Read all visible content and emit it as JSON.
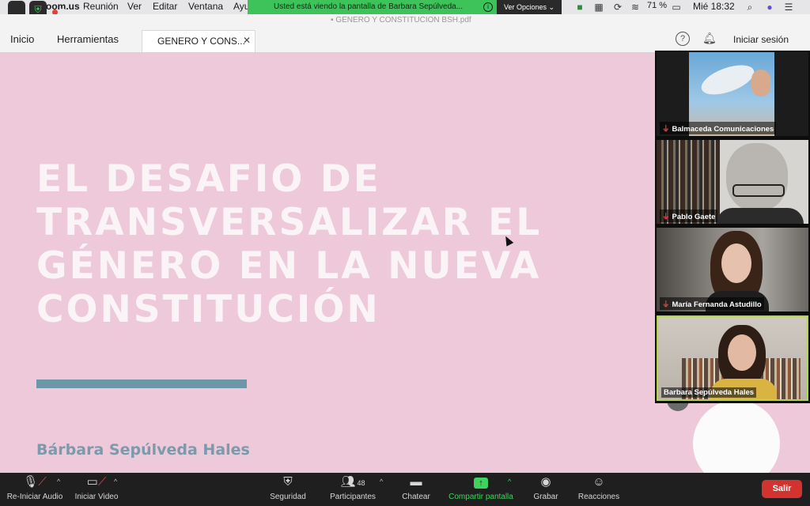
{
  "menubar": {
    "app": "zoom.us",
    "items": [
      "Reunión",
      "Ver",
      "Editar",
      "Ventana",
      "Ayu"
    ],
    "recording": "Recording",
    "battery": "71 %",
    "clock": "Mié 18:32"
  },
  "share_banner": {
    "text": "Usted está viendo la pantalla de Barbara Sepúlveda...",
    "view_options": "Ver Opciones"
  },
  "document": {
    "title": "GENERO Y CONSTITUCION BSH.pdf"
  },
  "tabbar": {
    "home": "Inicio",
    "tools": "Herramientas",
    "active_tab": "GENERO Y CONS...",
    "signin": "Iniciar sesión"
  },
  "slide": {
    "title": "EL DESAFIO DE TRANSVERSALIZAR EL GÉNERO EN LA NUEVA CONSTITUCIÓN",
    "author": "Bárbara Sepúlveda Hales"
  },
  "participants": [
    {
      "name": "Balmaceda Comunicaciones",
      "muted": true
    },
    {
      "name": "Pablo Gaete",
      "muted": true
    },
    {
      "name": "María Fernanda Astudillo",
      "muted": true
    },
    {
      "name": "Barbara Sepúlveda Hales",
      "muted": false,
      "active_speaker": true
    }
  ],
  "toolbar": {
    "audio": "Re-Iniciar Audio",
    "video": "Iniciar Video",
    "security": "Seguridad",
    "participants": "Participantes",
    "participants_count": "48",
    "chat": "Chatear",
    "share": "Compartir pantalla",
    "record": "Grabar",
    "reactions": "Reacciones",
    "leave": "Salir"
  },
  "colors": {
    "slide_bg": "#edc9d9",
    "slide_title": "#fbf4f7",
    "accent_bar": "#6d97a8",
    "author": "#7c9aac",
    "zoom_green": "#3fd35e",
    "leave_red": "#d3332e"
  }
}
